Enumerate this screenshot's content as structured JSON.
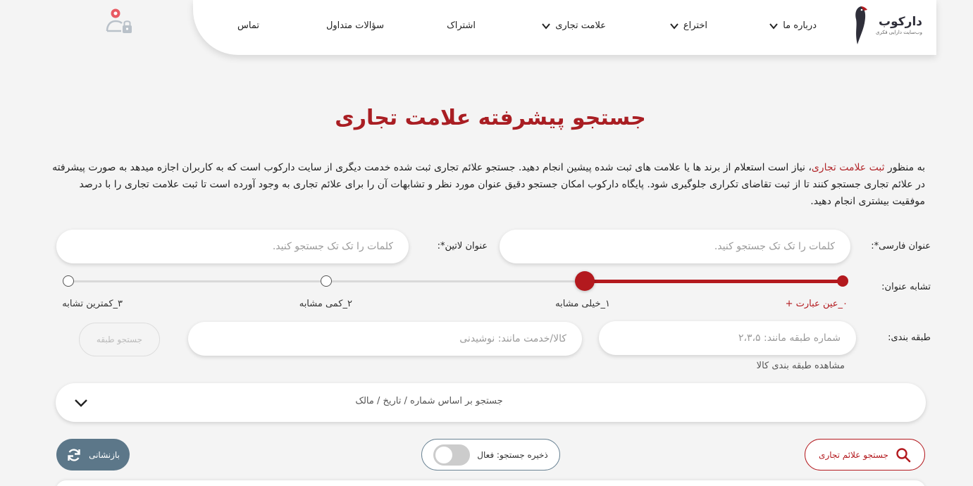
{
  "brand": {
    "name": "دارکوب",
    "tagline": "وب‌سایت دارایی فکری",
    "accent": "#a91e23"
  },
  "nav": {
    "items": [
      {
        "label": "درباره ما",
        "has_dropdown": true
      },
      {
        "label": "اختراع",
        "has_dropdown": true
      },
      {
        "label": "علامت تجاری",
        "has_dropdown": true
      },
      {
        "label": "اشتراک",
        "has_dropdown": false
      },
      {
        "label": "سؤالات متداول",
        "has_dropdown": false
      },
      {
        "label": "تماس",
        "has_dropdown": false
      }
    ],
    "user_icon": "user-lock-icon"
  },
  "page": {
    "title": "جستجو پیشرفته علامت تجاری",
    "intro_before": "به منظور ",
    "intro_link": "ثبت علامت تجاری",
    "intro_after": "، نیاز است استعلام از برند ها یا علامت های ثبت شده پیشین انجام دهید. جستجو علائم تجاری ثبت شده خدمت دیگری از سایت دارکوب است که به کاربران اجازه میدهد به صورت پیشرفته در علائم تجاری جستجو کنند تا از ثبت تقاضای تکراری جلوگیری شود. پایگاه دارکوب امکان جستجو دقیق عنوان مورد نظر و تشابهات آن را برای علائم تجاری به وجود آورده است تا ثبت علامت تجاری را با درصد موفقیت بیشتری انجام دهید."
  },
  "form": {
    "persian_title_label": "عنوان فارسی*:",
    "persian_title_placeholder": "کلمات را تک تک جستجو کنید.",
    "latin_title_label": "عنوان لاتین*:",
    "latin_title_placeholder": "کلمات را تک تک جستجو کنید.",
    "similarity_label": "تشابه عنوان:",
    "similarity_levels": [
      "۰_عین عبارت +",
      "۱_خیلی مشابه",
      "۲_کمی مشابه",
      "۳_کمترین تشابه"
    ],
    "similarity_selected": 1,
    "classification_label": "طبقه بندی:",
    "class_number_placeholder": "شماره طبقه مانند: ۲،۳،۵",
    "goods_placeholder": "کالا/خدمت مانند: نوشیدنی",
    "class_search_button": "جستجو طبقه",
    "goods_classification_link": "مشاهده طبقه بندی کالا",
    "accordion_label": "جستجو بر اساس شماره / تاریخ / مالک",
    "search_button": "جستجو علائم تجاری",
    "save_search_label": "ذخیره جستجو: فعال",
    "save_search_on": false,
    "reset_button": "بازنشانی"
  }
}
